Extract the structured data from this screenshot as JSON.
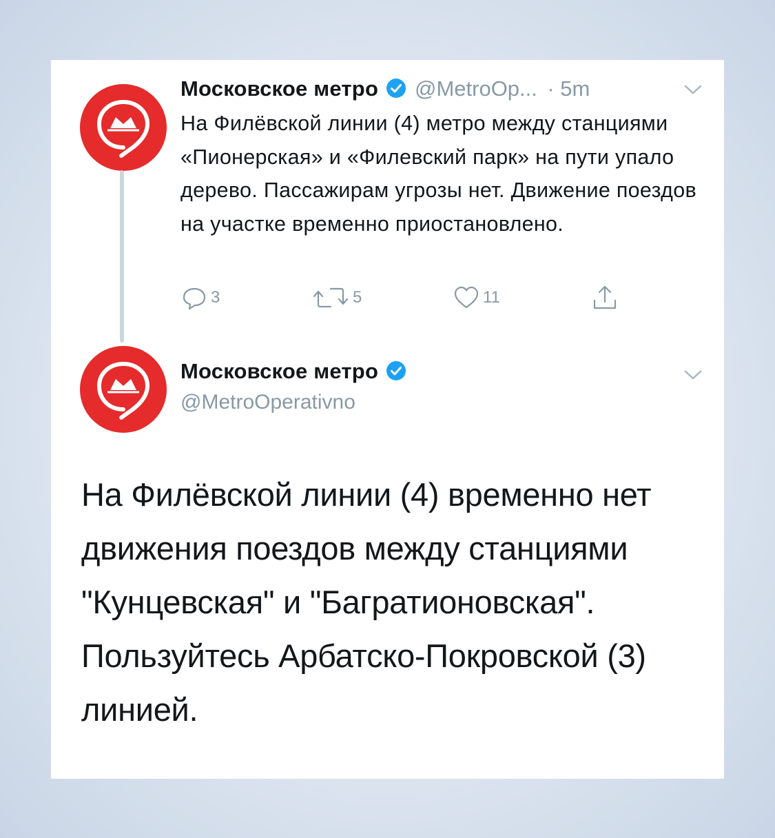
{
  "colors": {
    "brand_red": "#e52b2b",
    "verified_blue": "#1da1f2",
    "muted": "#8899a6",
    "text": "#14171a"
  },
  "tweet1": {
    "name": "Московское метро",
    "handle": "@MetroOp...",
    "time": "· 5m",
    "text": "На Филёвской линии (4) метро между станциями «Пионерская» и «Филевский парк» на пути упало дерево. Пассажирам угрозы нет. Движение поездов на участке временно приостановлено.",
    "actions": {
      "reply_count": "3",
      "retweet_count": "5",
      "like_count": "11"
    },
    "icons": [
      "verified-icon",
      "chevron-down-icon",
      "reply-icon",
      "retweet-icon",
      "like-icon",
      "share-icon"
    ]
  },
  "tweet2": {
    "name": "Московское метро",
    "handle": "@MetroOperativno",
    "text": "На Филёвской линии (4) временно нет движения поездов между станциями \"Кунцевская\" и \"Багратионовская\". Пользуйтесь Арбатско-Покровской (3) линией."
  }
}
